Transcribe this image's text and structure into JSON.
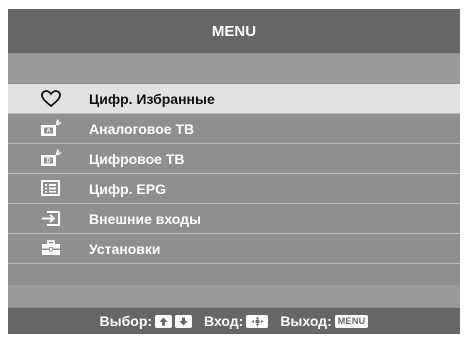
{
  "menu": {
    "title": "MENU",
    "items": [
      {
        "label": "Цифр. Избранные",
        "icon": "heart-icon",
        "selected": true
      },
      {
        "label": "Аналоговое ТВ",
        "icon": "analog-tv-icon",
        "selected": false
      },
      {
        "label": "Цифровое ТВ",
        "icon": "digital-tv-icon",
        "selected": false
      },
      {
        "label": "Цифр. EPG",
        "icon": "epg-list-icon",
        "selected": false
      },
      {
        "label": "Внешние входы",
        "icon": "external-input-icon",
        "selected": false
      },
      {
        "label": "Установки",
        "icon": "toolbox-icon",
        "selected": false
      }
    ]
  },
  "footer": {
    "select_label": "Выбор:",
    "enter_label": "Вход:",
    "exit_label": "Выход:",
    "menu_key": "MENU"
  },
  "colors": {
    "title_bar": "#666666",
    "panel": "#8f8f8f",
    "selected_row": "#e1e1e1",
    "text": "#ffffff"
  }
}
